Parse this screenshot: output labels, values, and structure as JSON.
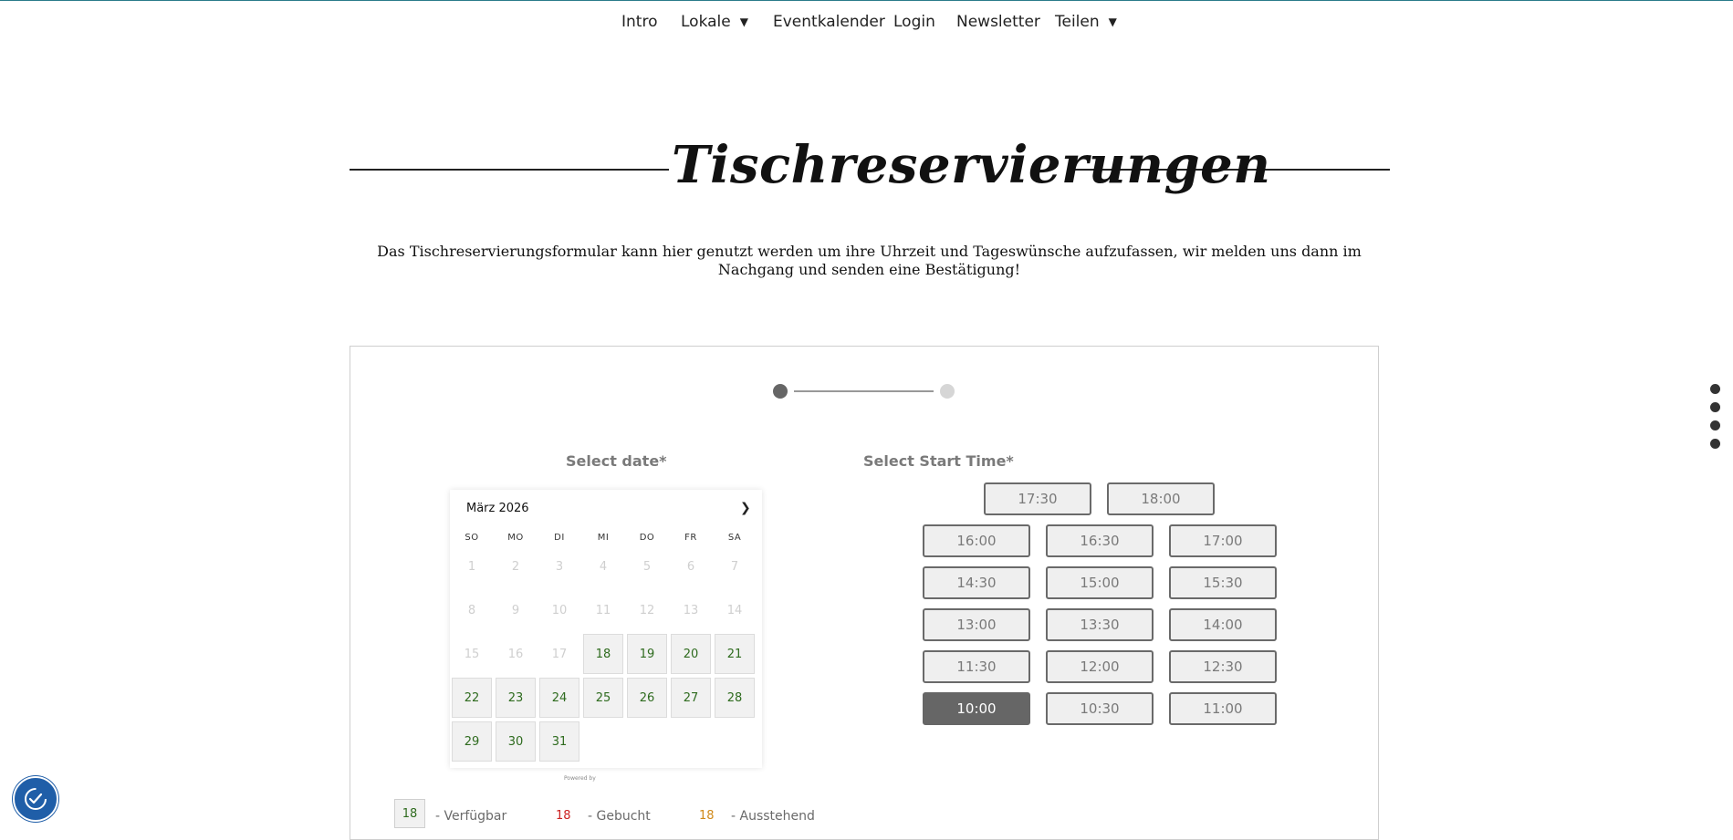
{
  "nav": {
    "intro": "Intro",
    "lokale": "Lokale",
    "eventkalender": "Eventkalender",
    "login": "Login",
    "newsletter": "Newsletter",
    "teilen": "Teilen"
  },
  "title": "Tischreservierungen",
  "intro_text": "Das Tischreservierungsformular kann hier genutzt werden um ihre Uhrzeit und Tageswünsche aufzufassen, wir melden uns dann im Nachgang und senden eine Bestätigung!",
  "form": {
    "date_label": "Select date*",
    "time_label": "Select Start Time*",
    "steps_total": 2,
    "current_step": 1
  },
  "calendar": {
    "month": "März 2026",
    "weekdays": [
      "SO",
      "MO",
      "DI",
      "MI",
      "DO",
      "FR",
      "SA"
    ],
    "days": [
      "1",
      "2",
      "3",
      "4",
      "5",
      "6",
      "7",
      "8",
      "9",
      "10",
      "11",
      "12",
      "13",
      "14",
      "15",
      "16",
      "17",
      "18",
      "19",
      "20",
      "21",
      "22",
      "23",
      "24",
      "25",
      "26",
      "27",
      "28",
      "29",
      "30",
      "31"
    ],
    "first_available_day": 18,
    "powered_by": "Powered by"
  },
  "times": [
    "17:30",
    "18:00",
    "16:00",
    "16:30",
    "17:00",
    "14:30",
    "15:00",
    "15:30",
    "13:00",
    "13:30",
    "14:00",
    "11:30",
    "12:00",
    "12:30",
    "10:00",
    "10:30",
    "11:00"
  ],
  "selected_time": "10:00",
  "legend": {
    "available_num": "18",
    "available_label": "- Verfügbar",
    "booked_num": "18",
    "booked_label": "- Gebucht",
    "pending_num": "18",
    "pending_label": "- Ausstehend"
  },
  "colors": {
    "available": "#2e6b1e",
    "booked": "#cc2222",
    "pending": "#d08a1a",
    "selected": "#666666",
    "accessibility": "#1f5ea8"
  },
  "icons": {
    "next_month": "chevron-right-icon",
    "dropdown": "chevron-down-icon",
    "accessibility": "accessibility-icon"
  }
}
